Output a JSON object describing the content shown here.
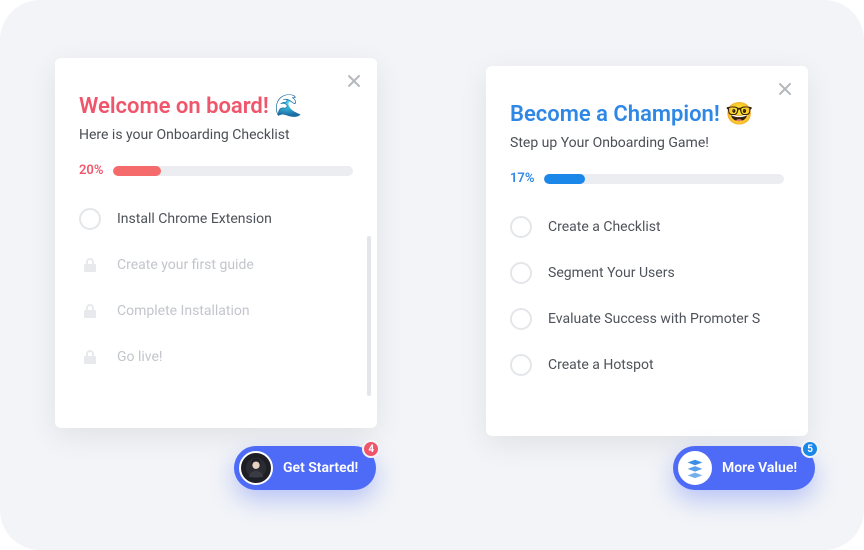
{
  "cards": [
    {
      "title": "Welcome on board!",
      "emoji": "🌊",
      "subtitle": "Here is your Onboarding Checklist",
      "percent": "20%",
      "fill": "20%",
      "color": "red",
      "items": [
        {
          "label": "Install Chrome Extension",
          "locked": false
        },
        {
          "label": "Create your first guide",
          "locked": true
        },
        {
          "label": "Complete Installation",
          "locked": true
        },
        {
          "label": "Go live!",
          "locked": true
        }
      ]
    },
    {
      "title": "Become a Champion!",
      "emoji": "🤓",
      "subtitle": "Step up Your Onboarding Game!",
      "percent": "17%",
      "fill": "17%",
      "color": "blue",
      "items": [
        {
          "label": "Create a Checklist",
          "locked": false
        },
        {
          "label": "Segment Your Users",
          "locked": false
        },
        {
          "label": "Evaluate Success with Promoter S",
          "locked": false
        },
        {
          "label": "Create a Hotspot",
          "locked": false
        }
      ]
    }
  ],
  "fabs": [
    {
      "label": "Get Started!",
      "badge": "4",
      "badgeColor": "red",
      "avatar": "face"
    },
    {
      "label": "More Value!",
      "badge": "5",
      "badgeColor": "blue",
      "avatar": "stack"
    }
  ]
}
